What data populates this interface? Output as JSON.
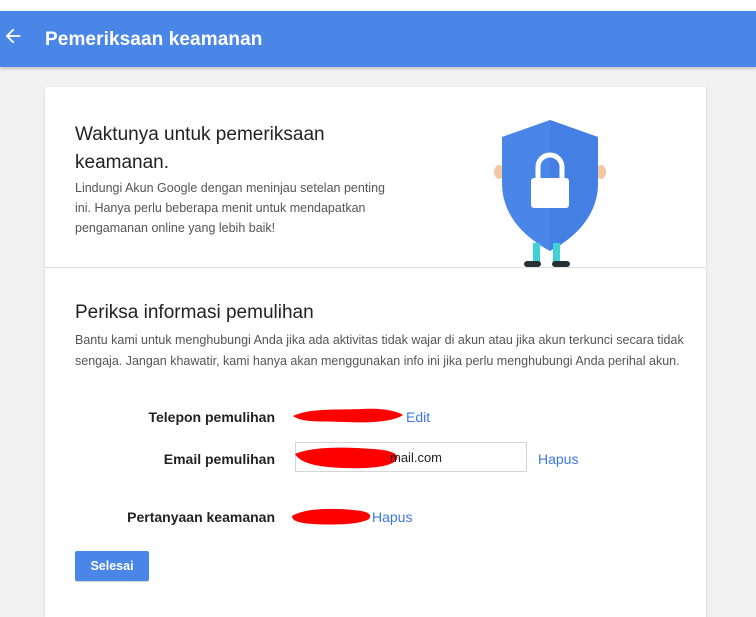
{
  "header": {
    "title": "Pemeriksaan keamanan",
    "back_icon": "arrow-back-icon"
  },
  "colors": {
    "accent": "#4a86e8",
    "link": "#3b78e7",
    "redaction": "#ff0000",
    "shield": "#4a86e8"
  },
  "intro": {
    "headline": "Waktunya untuk pemeriksaan keamanan.",
    "body": "Lindungi Akun Google dengan meninjau setelan penting ini. Hanya perlu beberapa menit untuk mendapatkan pengamanan online yang lebih baik!"
  },
  "recovery": {
    "title": "Periksa informasi pemulihan",
    "description": "Bantu kami untuk menghubungi Anda jika ada aktivitas tidak wajar di akun atau jika akun terkunci secara tidak sengaja. Jangan khawatir, kami hanya akan menggunakan info ini jika perlu menghubungi Anda perihal akun.",
    "phone": {
      "label": "Telepon pemulihan",
      "action": "Edit"
    },
    "email": {
      "label": "Email pemulihan",
      "value": "mail.com",
      "action": "Hapus"
    },
    "question": {
      "label": "Pertanyaan keamanan",
      "action": "Hapus"
    },
    "done_button": "Selesai"
  }
}
